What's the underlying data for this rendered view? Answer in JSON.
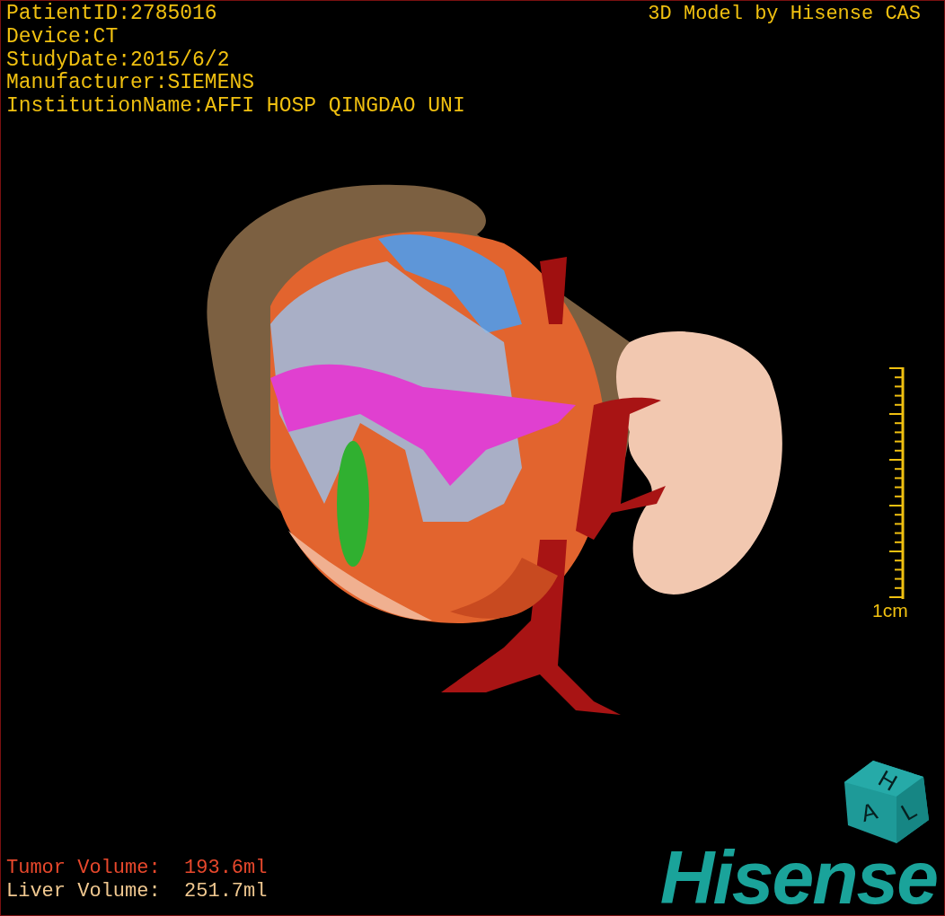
{
  "info_lines": [
    "PatientID:2785016",
    "Device:CT",
    "StudyDate:2015/6/2",
    "Manufacturer:SIEMENS",
    "InstitutionName:AFFI HOSP QINGDAO UNI"
  ],
  "title": "3D Model by Hisense CAS",
  "scale_bar": {
    "label": "1cm"
  },
  "orientation_cube": {
    "letters": [
      "H",
      "A",
      "L"
    ]
  },
  "volumes": [
    {
      "kind": "tumor",
      "text": "Tumor Volume:  193.6ml"
    },
    {
      "kind": "liver",
      "text": "Liver Volume:  251.7ml"
    }
  ],
  "logo": "Hisense"
}
